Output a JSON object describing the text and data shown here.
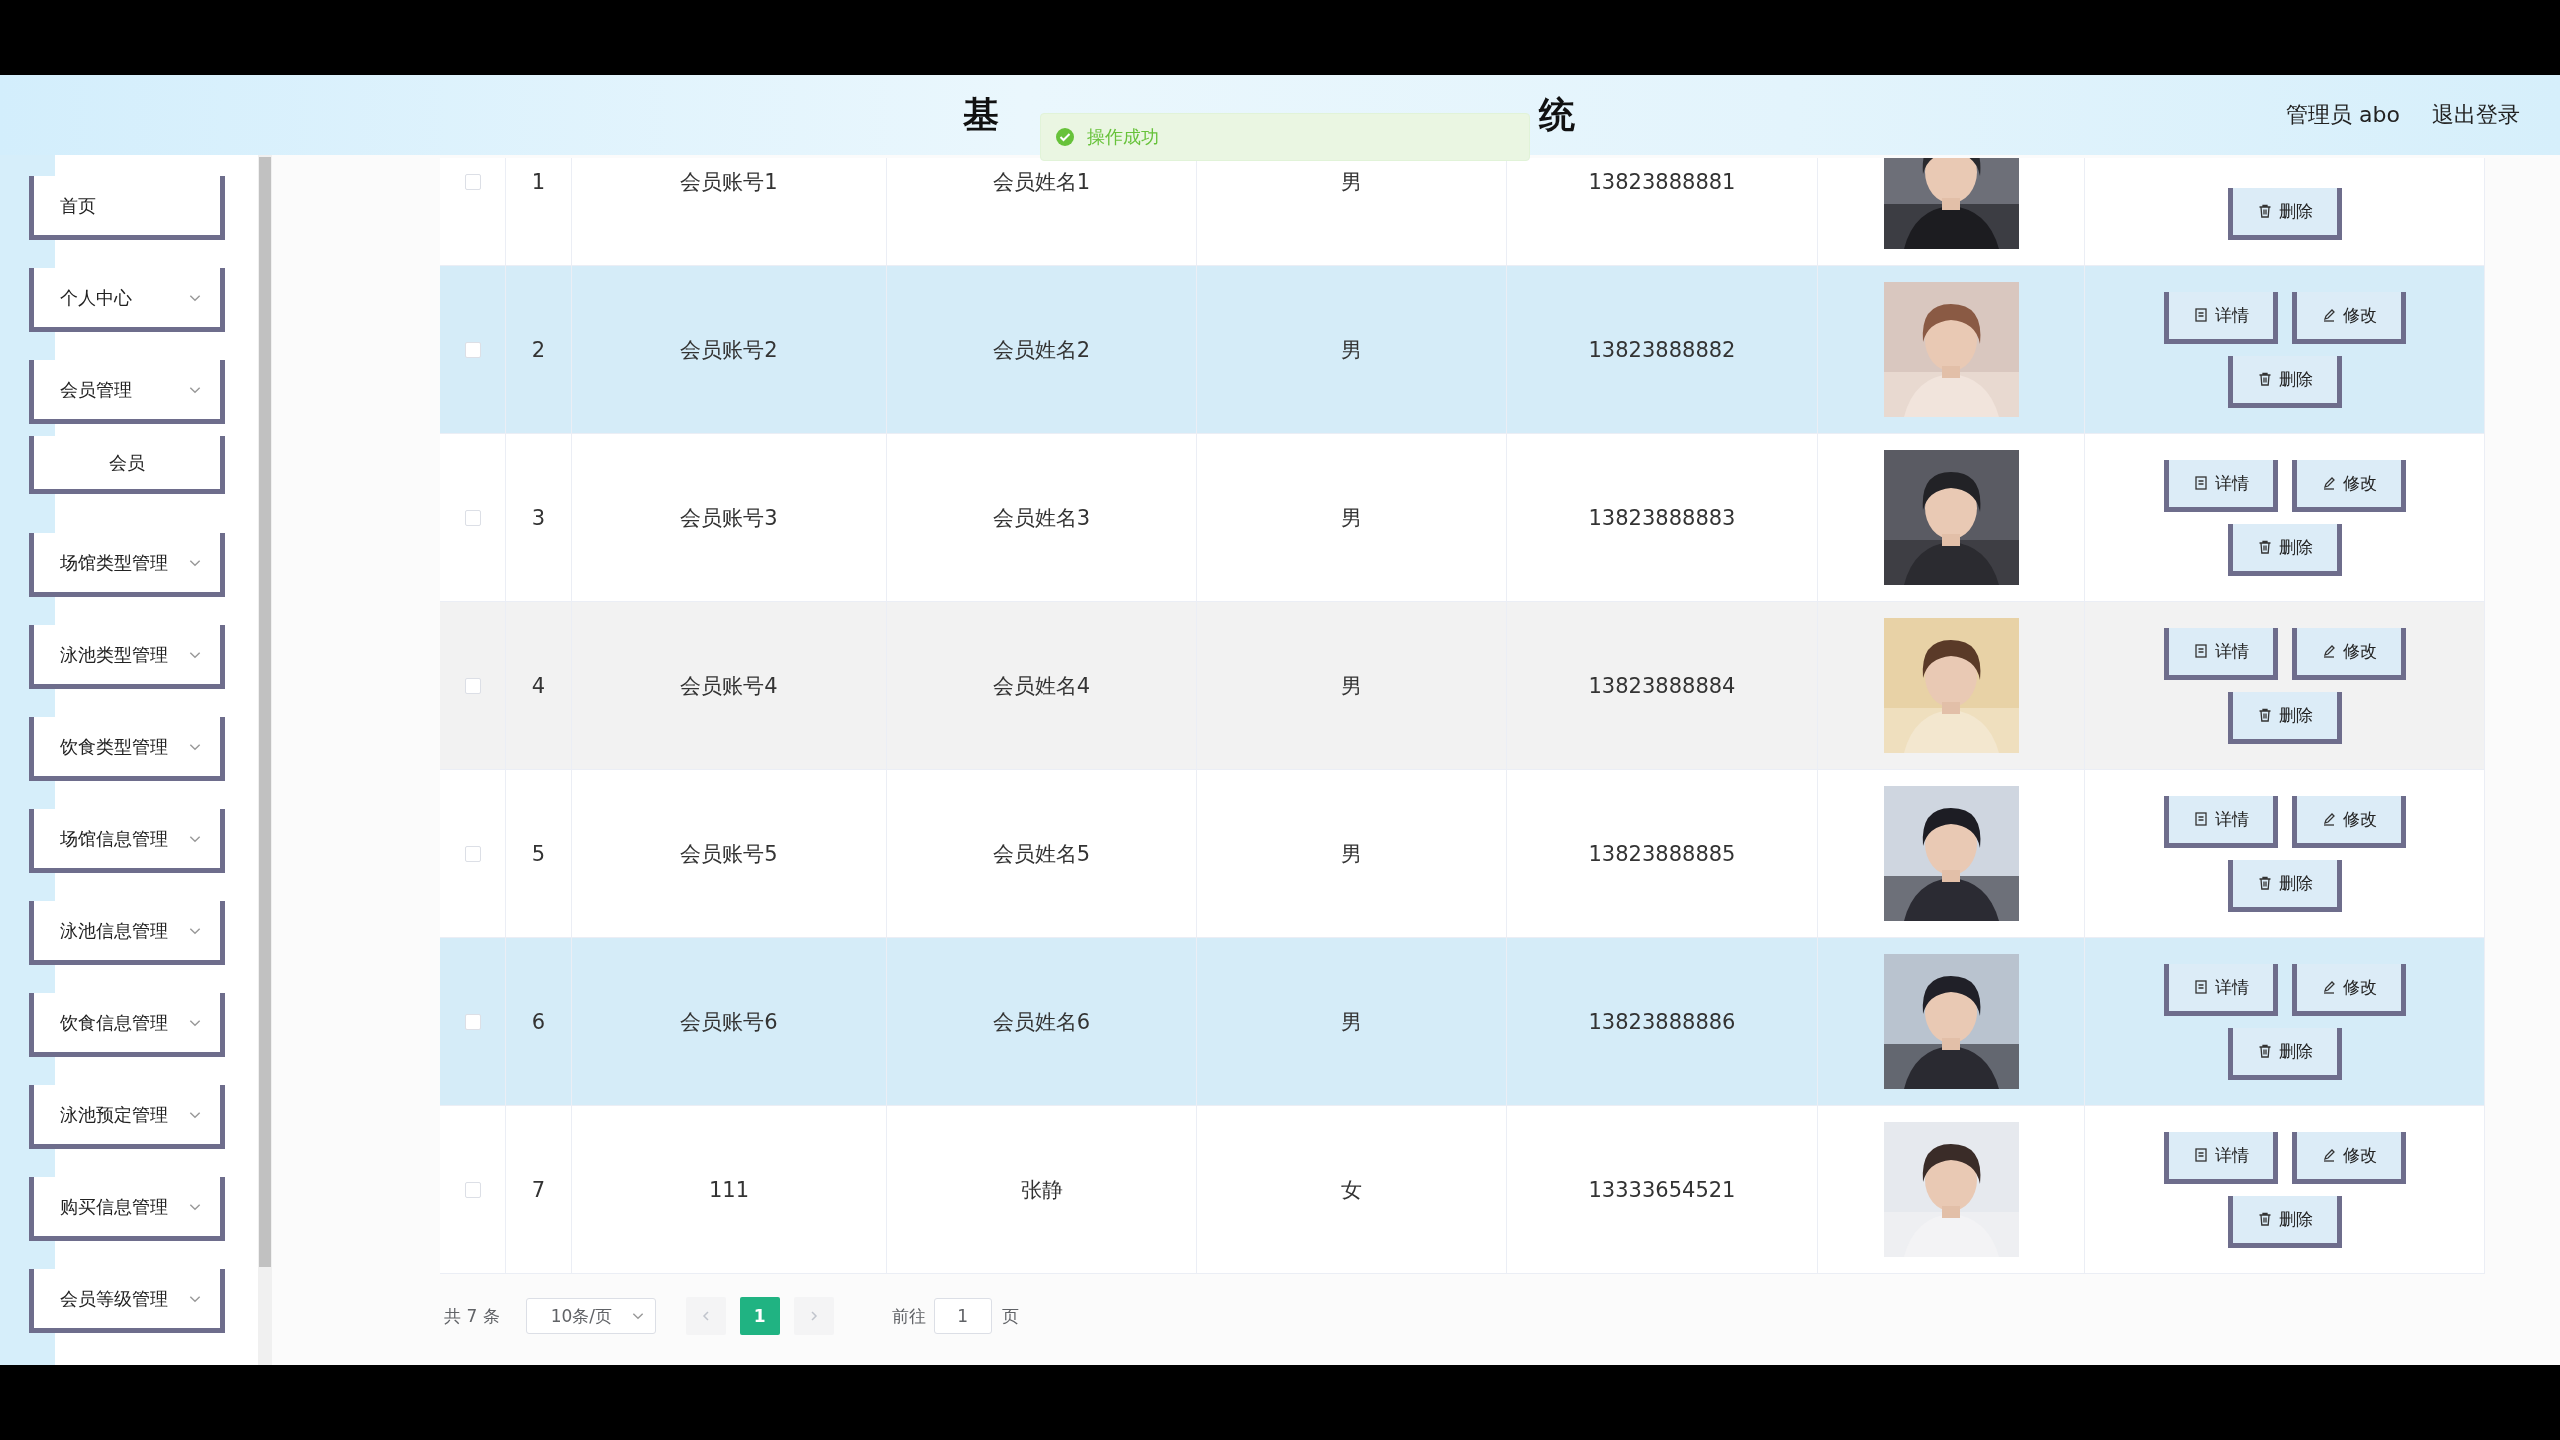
{
  "header": {
    "title_fragments": [
      "基",
      "统"
    ],
    "user": "管理员 abo",
    "logout": "退出登录"
  },
  "toast": {
    "message": "操作成功"
  },
  "sidebar": {
    "items": [
      {
        "label": "首页",
        "kind": "link"
      },
      {
        "label": "个人中心",
        "kind": "menu"
      },
      {
        "label": "会员管理",
        "kind": "menu",
        "children": [
          {
            "label": "会员"
          }
        ]
      },
      {
        "label": "场馆类型管理",
        "kind": "menu"
      },
      {
        "label": "泳池类型管理",
        "kind": "menu"
      },
      {
        "label": "饮食类型管理",
        "kind": "menu"
      },
      {
        "label": "场馆信息管理",
        "kind": "menu"
      },
      {
        "label": "泳池信息管理",
        "kind": "menu"
      },
      {
        "label": "饮食信息管理",
        "kind": "menu"
      },
      {
        "label": "泳池预定管理",
        "kind": "menu"
      },
      {
        "label": "购买信息管理",
        "kind": "menu"
      },
      {
        "label": "会员等级管理",
        "kind": "menu"
      }
    ]
  },
  "table": {
    "rows": [
      {
        "checked": false,
        "highlighted": false,
        "hovered": false,
        "index": "1",
        "account": "会员账号1",
        "name": "会员姓名1",
        "gender": "男",
        "phone": "13823888881",
        "avatar": {
          "kind": "picture"
        },
        "actions": [
          {
            "kind": "delete",
            "label": "删除"
          }
        ]
      },
      {
        "checked": false,
        "highlighted": true,
        "hovered": false,
        "index": "2",
        "account": "会员账号2",
        "name": "会员姓名2",
        "gender": "男",
        "phone": "13823888882",
        "avatar": {
          "kind": "picture"
        },
        "actions": [
          {
            "kind": "detail",
            "label": "详情"
          },
          {
            "kind": "edit",
            "label": "修改"
          },
          {
            "kind": "delete",
            "label": "删除"
          }
        ]
      },
      {
        "checked": false,
        "highlighted": false,
        "hovered": false,
        "index": "3",
        "account": "会员账号3",
        "name": "会员姓名3",
        "gender": "男",
        "phone": "13823888883",
        "avatar": {
          "kind": "picture"
        },
        "actions": [
          {
            "kind": "detail",
            "label": "详情"
          },
          {
            "kind": "edit",
            "label": "修改"
          },
          {
            "kind": "delete",
            "label": "删除"
          }
        ]
      },
      {
        "checked": false,
        "highlighted": false,
        "hovered": true,
        "index": "4",
        "account": "会员账号4",
        "name": "会员姓名4",
        "gender": "男",
        "phone": "13823888884",
        "avatar": {
          "kind": "picture"
        },
        "actions": [
          {
            "kind": "detail",
            "label": "详情"
          },
          {
            "kind": "edit",
            "label": "修改"
          },
          {
            "kind": "delete",
            "label": "删除"
          }
        ]
      },
      {
        "checked": false,
        "highlighted": false,
        "hovered": false,
        "index": "5",
        "account": "会员账号5",
        "name": "会员姓名5",
        "gender": "男",
        "phone": "13823888885",
        "avatar": {
          "kind": "picture"
        },
        "actions": [
          {
            "kind": "detail",
            "label": "详情"
          },
          {
            "kind": "edit",
            "label": "修改"
          },
          {
            "kind": "delete",
            "label": "删除"
          }
        ]
      },
      {
        "checked": false,
        "highlighted": true,
        "hovered": false,
        "index": "6",
        "account": "会员账号6",
        "name": "会员姓名6",
        "gender": "男",
        "phone": "13823888886",
        "avatar": {
          "kind": "picture"
        },
        "actions": [
          {
            "kind": "detail",
            "label": "详情"
          },
          {
            "kind": "edit",
            "label": "修改"
          },
          {
            "kind": "delete",
            "label": "删除"
          }
        ]
      },
      {
        "checked": false,
        "highlighted": false,
        "hovered": false,
        "index": "7",
        "account": "111",
        "name": "张静",
        "gender": "女",
        "phone": "13333654521",
        "avatar": {
          "kind": "picture"
        },
        "actions": [
          {
            "kind": "detail",
            "label": "详情"
          },
          {
            "kind": "edit",
            "label": "修改"
          },
          {
            "kind": "delete",
            "label": "删除"
          }
        ]
      }
    ]
  },
  "pagination": {
    "total": "共 7 条",
    "page_size": "10条/页",
    "pages": [
      {
        "label": "1",
        "selected": true
      }
    ],
    "goto_label": "前往",
    "goto_value": "1",
    "goto_suffix": "页"
  }
}
